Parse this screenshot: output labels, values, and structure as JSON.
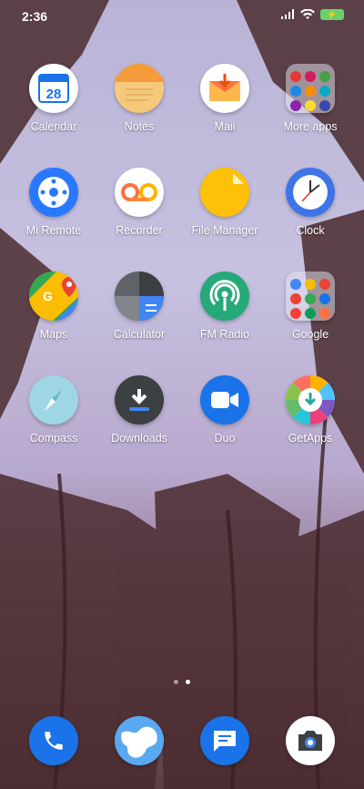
{
  "status": {
    "time": "2:36",
    "battery": "⚡"
  },
  "apps": [
    {
      "label": "Calendar",
      "icon": "calendar-icon",
      "date": "28"
    },
    {
      "label": "Notes",
      "icon": "notes-icon"
    },
    {
      "label": "Mail",
      "icon": "mail-icon"
    },
    {
      "label": "More apps",
      "icon": "folder-icon"
    },
    {
      "label": "Mi Remote",
      "icon": "remote-icon"
    },
    {
      "label": "Recorder",
      "icon": "recorder-icon"
    },
    {
      "label": "File Manager",
      "icon": "file-manager-icon"
    },
    {
      "label": "Clock",
      "icon": "clock-icon"
    },
    {
      "label": "Maps",
      "icon": "maps-icon"
    },
    {
      "label": "Calculator",
      "icon": "calculator-icon"
    },
    {
      "label": "FM Radio",
      "icon": "radio-icon"
    },
    {
      "label": "Google",
      "icon": "google-folder-icon"
    },
    {
      "label": "Compass",
      "icon": "compass-icon"
    },
    {
      "label": "Downloads",
      "icon": "downloads-icon"
    },
    {
      "label": "Duo",
      "icon": "duo-icon"
    },
    {
      "label": "GetApps",
      "icon": "getapps-icon"
    }
  ],
  "pager": {
    "pages": 2,
    "current": 2
  },
  "dock": [
    {
      "icon": "phone-icon"
    },
    {
      "icon": "browser-icon"
    },
    {
      "icon": "messages-icon"
    },
    {
      "icon": "camera-icon"
    }
  ],
  "colors": {
    "calendar": "#1a73e8",
    "notes": "#f6c97a",
    "mail": "#ff7043",
    "remote": "#2979ff",
    "files": "#ffc107",
    "clock": "#3f74e8",
    "radio": "#26a97a",
    "duo": "#1a73e8"
  }
}
